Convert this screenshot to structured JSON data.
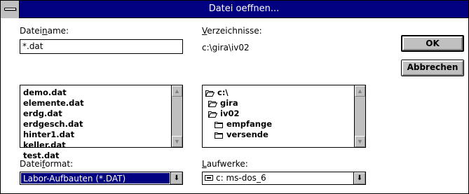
{
  "window": {
    "title": "Datei oeffnen..."
  },
  "filename": {
    "label_pre": "Datei",
    "label_accel": "n",
    "label_post": "ame:",
    "value": "*.dat",
    "files": [
      "demo.dat",
      "elemente.dat",
      "erdg.dat",
      "erdgesch.dat",
      "hinter1.dat",
      "keller.dat",
      "test.dat"
    ]
  },
  "directories": {
    "label_accel": "V",
    "label_post": "erzeichnisse:",
    "current_path": "c:\\gira\\iv02",
    "tree": [
      {
        "name": "c:\\",
        "state": "open"
      },
      {
        "name": "gira",
        "state": "open"
      },
      {
        "name": "iv02",
        "state": "open"
      },
      {
        "name": "empfange",
        "state": "closed"
      },
      {
        "name": "versende",
        "state": "closed"
      }
    ]
  },
  "file_format": {
    "label_pre": "Datei",
    "label_accel": "f",
    "label_post": "ormat:",
    "selected": "Labor-Aufbauten (*.DAT)"
  },
  "drives": {
    "label_accel": "L",
    "label_post": "aufwerke:",
    "selected": "c: ms-dos_6"
  },
  "buttons": {
    "ok": "OK",
    "cancel": "Abbrechen"
  },
  "icons": {
    "scroll_up": "up-arrow-icon",
    "scroll_down": "down-arrow-icon",
    "dropdown": "down-arrow-icon",
    "folder_open": "folder-open-icon",
    "folder_closed": "folder-closed-icon",
    "drive": "hard-drive-icon"
  },
  "colors": {
    "titlebar": "#000080",
    "selection": "#000080",
    "button_face": "#c0c0c0"
  }
}
